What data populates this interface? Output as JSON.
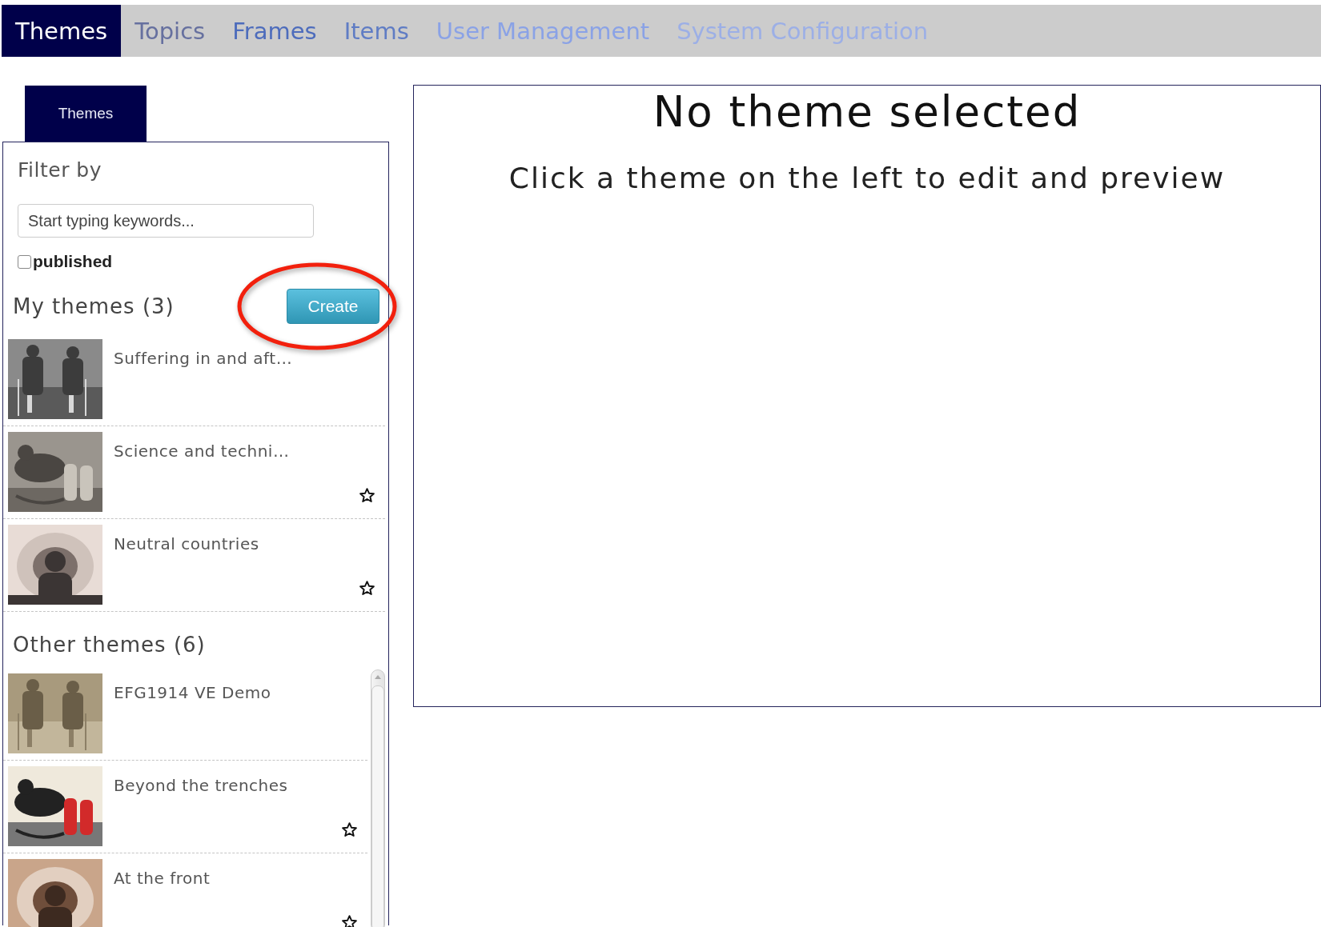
{
  "nav": {
    "tabs": [
      {
        "label": "Themes",
        "selected": true
      },
      {
        "label": "Topics",
        "selected": false,
        "color": "#66709f"
      },
      {
        "label": "Frames",
        "selected": false,
        "color": "#4d6cbc"
      },
      {
        "label": "Items",
        "selected": false,
        "color": "#5f7cc4"
      },
      {
        "label": "User Management",
        "selected": false,
        "color": "#8aa2e6"
      },
      {
        "label": "System Configuration",
        "selected": false,
        "color": "#9cafe6"
      }
    ]
  },
  "sidebar": {
    "tab": {
      "label": "Themes",
      "selected": true
    },
    "filter_label": "Filter by",
    "search": {
      "placeholder": "Start typing keywords..."
    },
    "published": {
      "label": "published",
      "checked": false
    },
    "my_themes": {
      "heading": "My themes (3)",
      "create_button": {
        "label": "Create",
        "highlighted": true
      },
      "items": [
        {
          "title": "Suffering in and aft…",
          "favorite_icon": false
        },
        {
          "title": "Science and techni…",
          "favorite_icon": true
        },
        {
          "title": "Neutral countries",
          "favorite_icon": true
        }
      ]
    },
    "other_themes": {
      "heading": "Other themes (6)",
      "items": [
        {
          "title": "EFG1914 VE Demo",
          "favorite_icon": false
        },
        {
          "title": "Beyond the trenches",
          "favorite_icon": true
        },
        {
          "title": "At the front",
          "favorite_icon": true
        }
      ]
    }
  },
  "main": {
    "title": "No theme selected",
    "subtitle": "Click a theme on the left to edit and preview"
  }
}
